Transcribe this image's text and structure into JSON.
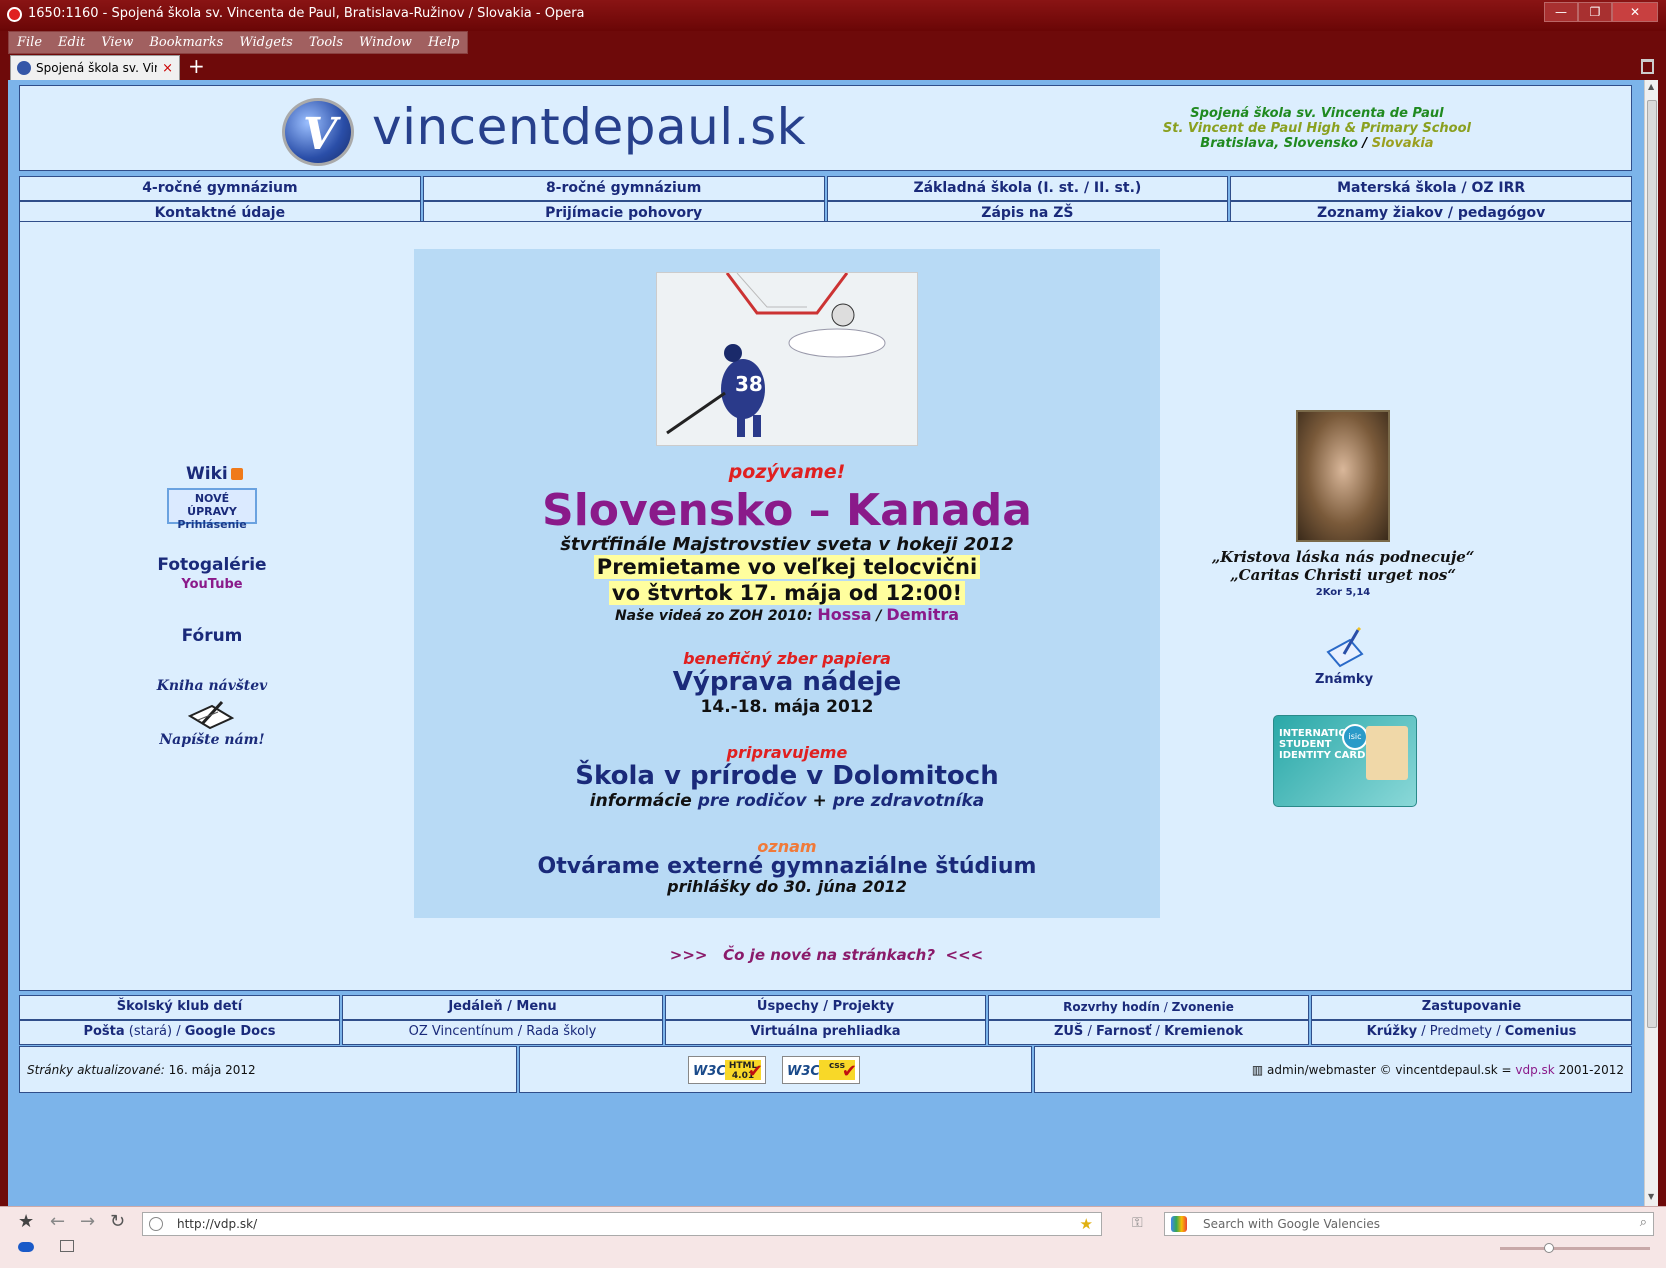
{
  "window": {
    "title": "1650:1160 - Spojená škola sv. Vincenta de Paul, Bratislava-Ružinov / Slovakia - Opera",
    "controls": [
      "—",
      "❐",
      "✕"
    ]
  },
  "menu": [
    "File",
    "Edit",
    "View",
    "Bookmarks",
    "Widgets",
    "Tools",
    "Window",
    "Help"
  ],
  "tab": {
    "label": "Spojená škola sv. Vince...",
    "close": "×",
    "new_tab": "+"
  },
  "header": {
    "site_name": "vincentdepaul.sk",
    "logo_letter": "V",
    "school_line1": "Spojená škola sv. Vincenta de Paul",
    "school_line2": "St. Vincent de Paul High & Primary School",
    "school_city": "Bratislava, Slovensko",
    "school_sep": "/",
    "school_country": "Slovakia"
  },
  "nav_top": [
    "4-ročné gymnázium",
    "8-ročné gymnázium",
    "Základná škola (I. st. / II. st.)",
    "Materská škola / OZ IRR"
  ],
  "nav_second": [
    "Kontaktné údaje",
    "Prijímacie pohovory",
    "Zápis na ZŠ",
    "Zoznamy žiakov / pedagógov"
  ],
  "left": {
    "wiki": "Wiki",
    "wiki_box_title": "NOVÉ ÚPRAVY",
    "wiki_box_login": "Prihlásenie",
    "fotogalerie": "Fotogalérie",
    "youtube": "YouTube",
    "forum": "Fórum",
    "kniha": "Kniha návštev",
    "napiste": "Napíšte nám!"
  },
  "center": {
    "pozyvame": "pozývame!",
    "match": "Slovensko – Kanada",
    "subtitle": "štvrťfinále Majstrovstiev sveta v hokeji 2012",
    "premietame": "Premietame vo veľkej telocvični",
    "datetime": "vo štvrtok 17. mája od 12:00!",
    "videos_prefix": "Naše videá zo ZOH 2010:",
    "video1": "Hossa",
    "video_sep": "/",
    "video2": "Demitra",
    "benef": "benefičný zber papiera",
    "vyprava": "Výprava nádeje",
    "vyprava_date": "14.-18. mája 2012",
    "pripravujeme": "pripravujeme",
    "skola": "Škola v prírode v Dolomitoch",
    "info_prefix": "informácie",
    "info_parents": "pre rodičov",
    "info_plus": "+",
    "info_medics": "pre zdravotníka",
    "oznam": "oznam",
    "otvarame": "Otvárame externé gymnaziálne štúdium",
    "prihlasky": "prihlášky do 30. júna 2012",
    "co_je_nove": ">>>   Čo je nové na stránkach?  <<<",
    "jersey_number": "38"
  },
  "right": {
    "quote1": "„Kristova láska nás podnecuje“",
    "quote2": "„Caritas Christi urget nos“",
    "quote_ref": "2Kor 5,14",
    "znamky": "Známky",
    "isic_label1": "INTERNATIONAL",
    "isic_label2": "STUDENT",
    "isic_label3": "IDENTITY CARD",
    "isic_logo": "isic"
  },
  "nav_bottom": [
    {
      "parts": [
        "Školský klub detí"
      ]
    },
    {
      "parts": [
        "Jedáleň",
        " / ",
        "Menu"
      ]
    },
    {
      "parts": [
        "Úspechy",
        " / ",
        "Projekty"
      ]
    },
    {
      "parts": [
        "Rozvrhy hodín",
        " / ",
        "Zvonenie"
      ]
    },
    {
      "parts": [
        "Zastupovanie"
      ]
    }
  ],
  "nav_bottom2": {
    "posta": "Pošta",
    "stara": "(stará)",
    "sep1": " / ",
    "google_docs": "Google Docs",
    "oz": "OZ Vincentínum",
    "sep2": " / ",
    "rada": "Rada školy",
    "virtualna": "Virtuálna prehliadka",
    "zus": "ZUŠ",
    "sep3": " / ",
    "farnost": "Farnosť",
    "sep4": " / ",
    "kremienok": "Kremienok",
    "kruzky": "Krúžky",
    "sep5": " / ",
    "predmety": "Predmety",
    "sep6": " / ",
    "comenius": "Comenius"
  },
  "footer": {
    "updated_label": "Stránky aktualizované:",
    "updated_date": "16. mája 2012",
    "w3c_html_t": "W3C",
    "w3c_html_badge": "HTML 4.01",
    "w3c_css_t": "W3C",
    "w3c_css_badge": "css",
    "admin": "admin/webmaster © vincentdepaul.sk =",
    "vdp": "vdp.sk",
    "years": "2001-2012"
  },
  "statusbar": {
    "url": "http://vdp.sk/",
    "search_placeholder": "Search with Google Valencies"
  }
}
